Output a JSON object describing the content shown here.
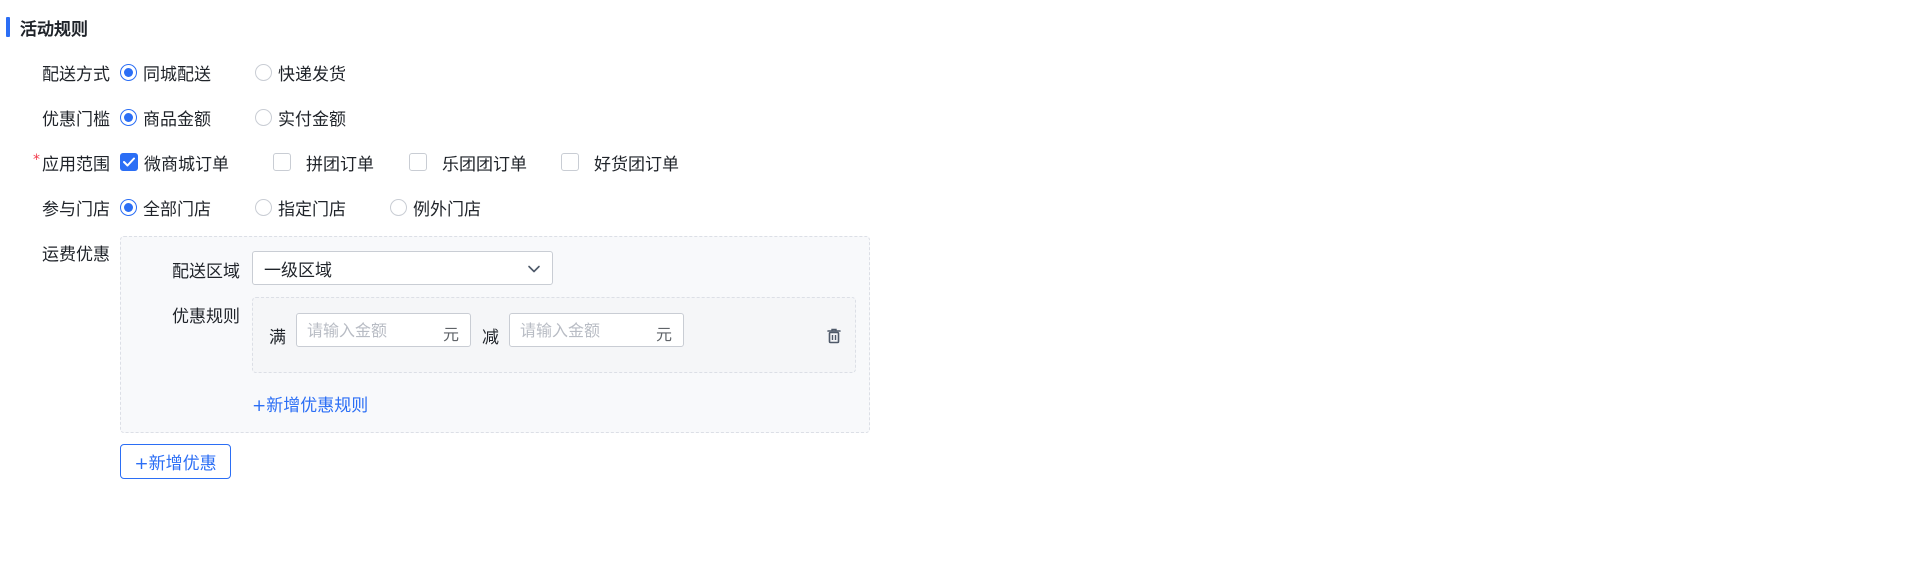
{
  "section": {
    "title": "活动规则"
  },
  "delivery": {
    "label": "配送方式",
    "options": [
      {
        "label": "同城配送",
        "selected": true
      },
      {
        "label": "快递发货",
        "selected": false
      }
    ]
  },
  "threshold": {
    "label": "优惠门槛",
    "options": [
      {
        "label": "商品金额",
        "selected": true
      },
      {
        "label": "实付金额",
        "selected": false
      }
    ]
  },
  "scope": {
    "required_mark": "*",
    "label": "应用范围",
    "options": [
      {
        "label": "微商城订单",
        "checked": true
      },
      {
        "label": "拼团订单",
        "checked": false
      },
      {
        "label": "乐团团订单",
        "checked": false
      },
      {
        "label": "好货团订单",
        "checked": false
      }
    ]
  },
  "stores": {
    "label": "参与门店",
    "options": [
      {
        "label": "全部门店",
        "selected": true
      },
      {
        "label": "指定门店",
        "selected": false
      },
      {
        "label": "例外门店",
        "selected": false
      }
    ]
  },
  "freight": {
    "label": "运费优惠",
    "area_label": "配送区域",
    "area_value": "一级区域",
    "rule_label": "优惠规则",
    "rule": {
      "full_word": "满",
      "minus_word": "减",
      "full_placeholder": "请输入金额",
      "minus_placeholder": "请输入金额",
      "unit": "元"
    },
    "add_rule": "+新增优惠规则"
  },
  "add_discount": "+新增优惠",
  "colors": {
    "accent": "#2b6ef5",
    "required": "#f2394a"
  }
}
